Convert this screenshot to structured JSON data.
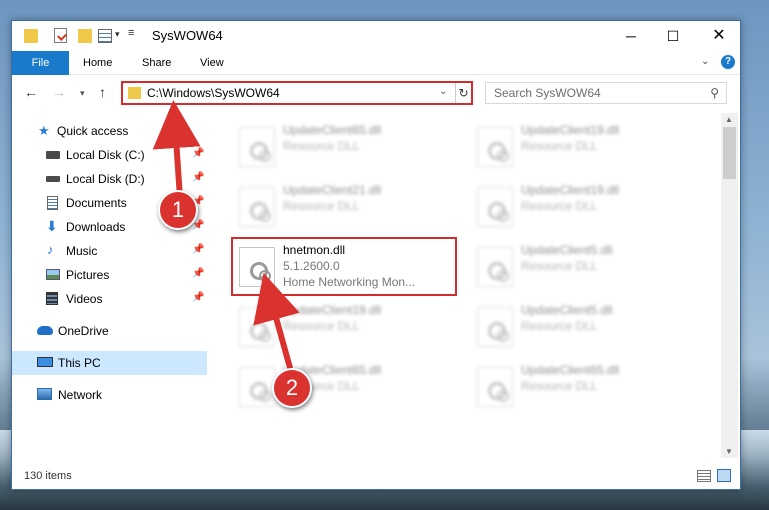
{
  "window": {
    "title": "SysWOW64",
    "controls": {
      "minimize": "─",
      "maximize": "☐",
      "close": "✕"
    }
  },
  "ribbon": {
    "tabs": [
      "File",
      "Home",
      "Share",
      "View"
    ]
  },
  "address": {
    "path": "C:\\Windows\\SysWOW64",
    "search_placeholder": "Search SysWOW64"
  },
  "sidebar": {
    "items": [
      {
        "label": "Quick access",
        "icon": "star-icon",
        "pinned": false
      },
      {
        "label": "Local Disk (C:)",
        "icon": "drive-icon",
        "pinned": true
      },
      {
        "label": "Local Disk (D:)",
        "icon": "drive-icon",
        "pinned": true
      },
      {
        "label": "Documents",
        "icon": "documents-icon",
        "pinned": true
      },
      {
        "label": "Downloads",
        "icon": "downloads-icon",
        "pinned": true
      },
      {
        "label": "Music",
        "icon": "music-icon",
        "pinned": true
      },
      {
        "label": "Pictures",
        "icon": "pictures-icon",
        "pinned": true
      },
      {
        "label": "Videos",
        "icon": "videos-icon",
        "pinned": true
      },
      {
        "label": "OneDrive",
        "icon": "onedrive-icon",
        "pinned": false
      },
      {
        "label": "This PC",
        "icon": "computer-icon",
        "pinned": false,
        "selected": true
      },
      {
        "label": "Network",
        "icon": "network-icon",
        "pinned": false
      }
    ]
  },
  "files": [
    {
      "name": "UpdateClient65.dll",
      "line2": "Resource DLL",
      "line3": "",
      "blurred": true
    },
    {
      "name": "UpdateClient19.dll",
      "line2": "Resource DLL",
      "line3": "",
      "blurred": true
    },
    {
      "name": "UpdateClient21.dll",
      "line2": "Resource DLL",
      "line3": "",
      "blurred": true
    },
    {
      "name": "UpdateClient19.dll",
      "line2": "Resource DLL",
      "line3": "",
      "blurred": true
    },
    {
      "name": "hnetmon.dll",
      "line2": "5.1.2600.0",
      "line3": "Home Networking Mon...",
      "blurred": false
    },
    {
      "name": "UpdateClient5.dll",
      "line2": "Resource DLL",
      "line3": "",
      "blurred": true
    },
    {
      "name": "UpdateClient19.dll",
      "line2": "Resource DLL",
      "line3": "",
      "blurred": true
    },
    {
      "name": "UpdateClient5.dll",
      "line2": "Resource DLL",
      "line3": "",
      "blurred": true
    },
    {
      "name": "UpdateClient65.dll",
      "line2": "Resource DLL",
      "line3": "",
      "blurred": true
    },
    {
      "name": "UpdateClient65.dll",
      "line2": "Resource DLL",
      "line3": "",
      "blurred": true
    }
  ],
  "status": {
    "item_count": "130 items"
  },
  "annotations": {
    "step1": "1",
    "step2": "2",
    "color": "#d9322f"
  }
}
